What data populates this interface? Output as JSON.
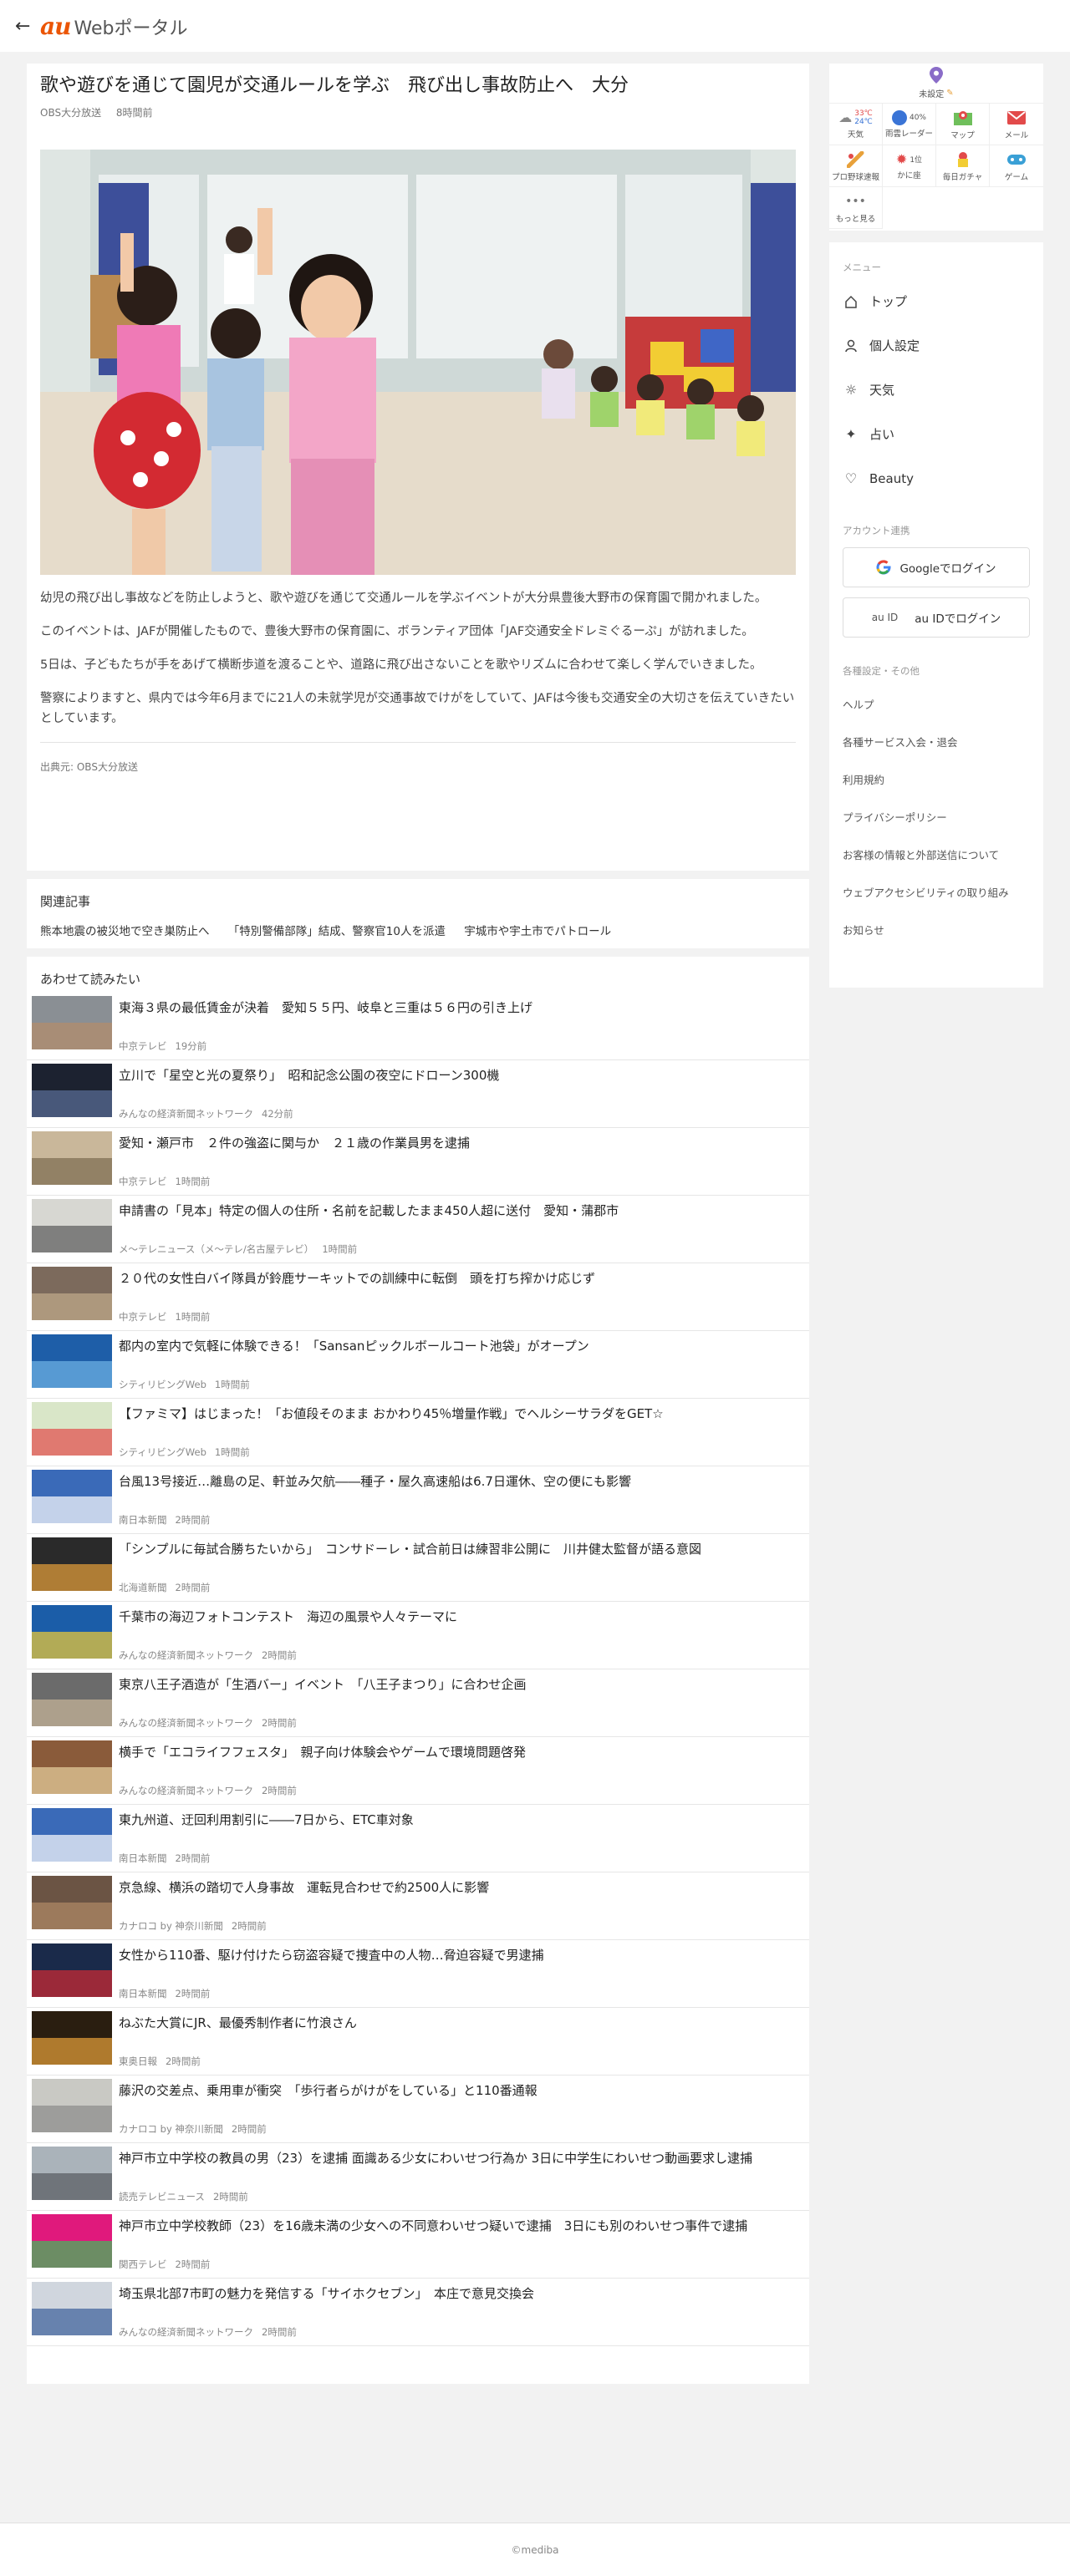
{
  "header": {
    "back": "←",
    "logo_mark": "au",
    "logo_text": "Webポータル"
  },
  "article": {
    "title": "歌や遊びを通じて園児が交通ルールを学ぶ　飛び出し事故防止へ　大分",
    "publisher": "OBS大分放送",
    "time": "8時間前",
    "paragraphs": [
      "幼児の飛び出し事故などを防止しようと、歌や遊びを通じて交通ルールを学ぶイベントが大分県豊後大野市の保育園で開かれました。",
      "このイベントは、JAFが開催したもので、豊後大野市の保育園に、ボランティア団体「JAF交通安全ドレミぐるーぷ」が訪れました。",
      "5日は、子どもたちが手をあげて横断歩道を渡ることや、道路に飛び出さないことを歌やリズムに合わせて楽しく学んでいきました。",
      "警察によりますと、県内では今年6月までに21人の未就学児が交通事故でけがをしていて、JAFは今後も交通安全の大切さを伝えていきたいとしています。"
    ],
    "source": "出典元: OBS大分放送"
  },
  "related": {
    "title": "関連記事",
    "links": [
      "熊本地震の被災地で空き巣防止へ",
      "「特別警備部隊」結成、警察官10人を派遣",
      "宇城市や宇土市でパトロール"
    ]
  },
  "also": {
    "title": "あわせて読みたい",
    "items": [
      {
        "title": "東海３県の最低賃金が決着　愛知５５円、岐阜と三重は５６円の引き上げ",
        "source": "中京テレビ",
        "time": "19分前"
      },
      {
        "title": "立川で「星空と光の夏祭り」　昭和記念公園の夜空にドローン300機",
        "source": "みんなの経済新聞ネットワーク",
        "time": "42分前"
      },
      {
        "title": "愛知・瀬戸市　２件の強盗に関与か　２１歳の作業員男を逮捕",
        "source": "中京テレビ",
        "time": "1時間前"
      },
      {
        "title": "申請書の「見本」特定の個人の住所・名前を記載したまま450人超に送付　愛知・蒲郡市",
        "source": "メ〜テレニュース（メ〜テレ/名古屋テレビ）",
        "time": "1時間前"
      },
      {
        "title": "２０代の女性白バイ隊員が鈴鹿サーキットでの訓練中に転倒　頭を打ち搾かけ応じず",
        "source": "中京テレビ",
        "time": "1時間前"
      },
      {
        "title": "都内の室内で気軽に体験できる！「Sansanピックルボールコート池袋」がオープン",
        "source": "シティリビングWeb",
        "time": "1時間前"
      },
      {
        "title": "【ファミマ】はじまった！「お値段そのまま おかわり45％増量作戦」でヘルシーサラダをGET☆",
        "source": "シティリビングWeb",
        "time": "1時間前"
      },
      {
        "title": "台風13号接近…離島の足、軒並み欠航――種子・屋久高速船は6.7日運休、空の便にも影響",
        "source": "南日本新聞",
        "time": "2時間前"
      },
      {
        "title": "「シンプルに毎試合勝ちたいから」　コンサドーレ・試合前日は練習非公開に　川井健太監督が語る意図",
        "source": "北海道新聞",
        "time": "2時間前"
      },
      {
        "title": "千葉市の海辺フォトコンテスト　海辺の風景や人々テーマに",
        "source": "みんなの経済新聞ネットワーク",
        "time": "2時間前"
      },
      {
        "title": "東京八王子酒造が「生酒バー」イベント　「八王子まつり」に合わせ企画",
        "source": "みんなの経済新聞ネットワーク",
        "time": "2時間前"
      },
      {
        "title": "横手で「エコライフフェスタ」　親子向け体験会やゲームで環境問題啓発",
        "source": "みんなの経済新聞ネットワーク",
        "time": "2時間前"
      },
      {
        "title": "東九州道、迂回利用割引に――7日から、ETC車対象",
        "source": "南日本新聞",
        "time": "2時間前"
      },
      {
        "title": "京急線、横浜の踏切で人身事故　運転見合わせで約2500人に影響",
        "source": "カナロコ by 神奈川新聞",
        "time": "2時間前"
      },
      {
        "title": "女性から110番、駆け付けたら窃盗容疑で捜査中の人物…脅迫容疑で男逮捕",
        "source": "南日本新聞",
        "time": "2時間前"
      },
      {
        "title": "ねぶた大賞にJR、最優秀制作者に竹浪さん",
        "source": "東奥日報",
        "time": "2時間前"
      },
      {
        "title": "藤沢の交差点、乗用車が衝突　「歩行者らがけがをしている」と110番通報",
        "source": "カナロコ by 神奈川新聞",
        "time": "2時間前"
      },
      {
        "title": "神戸市立中学校の教員の男（23）を逮捕 面識ある少女にわいせつ行為か 3日に中学生にわいせつ動画要求し逮捕",
        "source": "読売テレビニュース",
        "time": "2時間前"
      },
      {
        "title": "神戸市立中学校教師（23）を16歳未満の少女への不同意わいせつ疑いで逮捕　3日にも別のわいせつ事件で逮捕",
        "source": "関西テレビ",
        "time": "2時間前"
      },
      {
        "title": "埼玉県北部7市町の魅力を発信する「サイホクセブン」　本庄で意見交換会",
        "source": "みんなの経済新聞ネットワーク",
        "time": "2時間前"
      }
    ]
  },
  "services": {
    "location": "未設定",
    "weather": {
      "high": "33℃",
      "low": "24℃",
      "label": "天気"
    },
    "rain": {
      "pct": "40%",
      "label": "雨雲レーダー"
    },
    "map": "マップ",
    "mail": "メール",
    "baseball": "プロ野球速報",
    "crab": {
      "badge": "1位",
      "label": "かに座"
    },
    "gacha": "毎日ガチャ",
    "game": "ゲーム",
    "more": "もっと見る"
  },
  "menu": {
    "caption": "メニュー",
    "items": [
      {
        "label": "トップ"
      },
      {
        "label": "個人設定"
      },
      {
        "label": "天気"
      },
      {
        "label": "占い"
      },
      {
        "label": "Beauty"
      }
    ],
    "account_caption": "アカウント連携",
    "google_login": "Googleでログイン",
    "auid_alt": "au ID",
    "auid_login": "au IDでログイン",
    "other_caption": "各種設定・その他",
    "links": [
      "ヘルプ",
      "各種サービス入会・退会",
      "利用規約",
      "プライバシーポリシー",
      "お客様の情報と外部送信について",
      "ウェブアクセシビリティの取り組み",
      "お知らせ"
    ]
  },
  "footer": {
    "copyright": "©mediba"
  }
}
